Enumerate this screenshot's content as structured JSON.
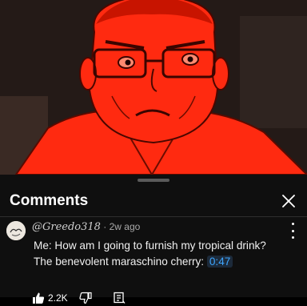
{
  "header": {
    "title": "Comments"
  },
  "icons": {
    "close": "close-icon",
    "more": "more-vert-icon",
    "like": "thumbs-up-icon",
    "dislike": "thumbs-down-icon",
    "reply": "reply-icon"
  },
  "comment": {
    "author": "@Greedo318",
    "age": "2w ago",
    "line1": "Me: How am I going to furnish my tropical drink?",
    "line2": "The benevolent maraschino cherry: ",
    "timestamp": "0:47",
    "likes": "2.2K"
  },
  "colors": {
    "link": "#3ea6ff",
    "tint": "#ff2a10",
    "sheet": "#0f0f0f"
  }
}
